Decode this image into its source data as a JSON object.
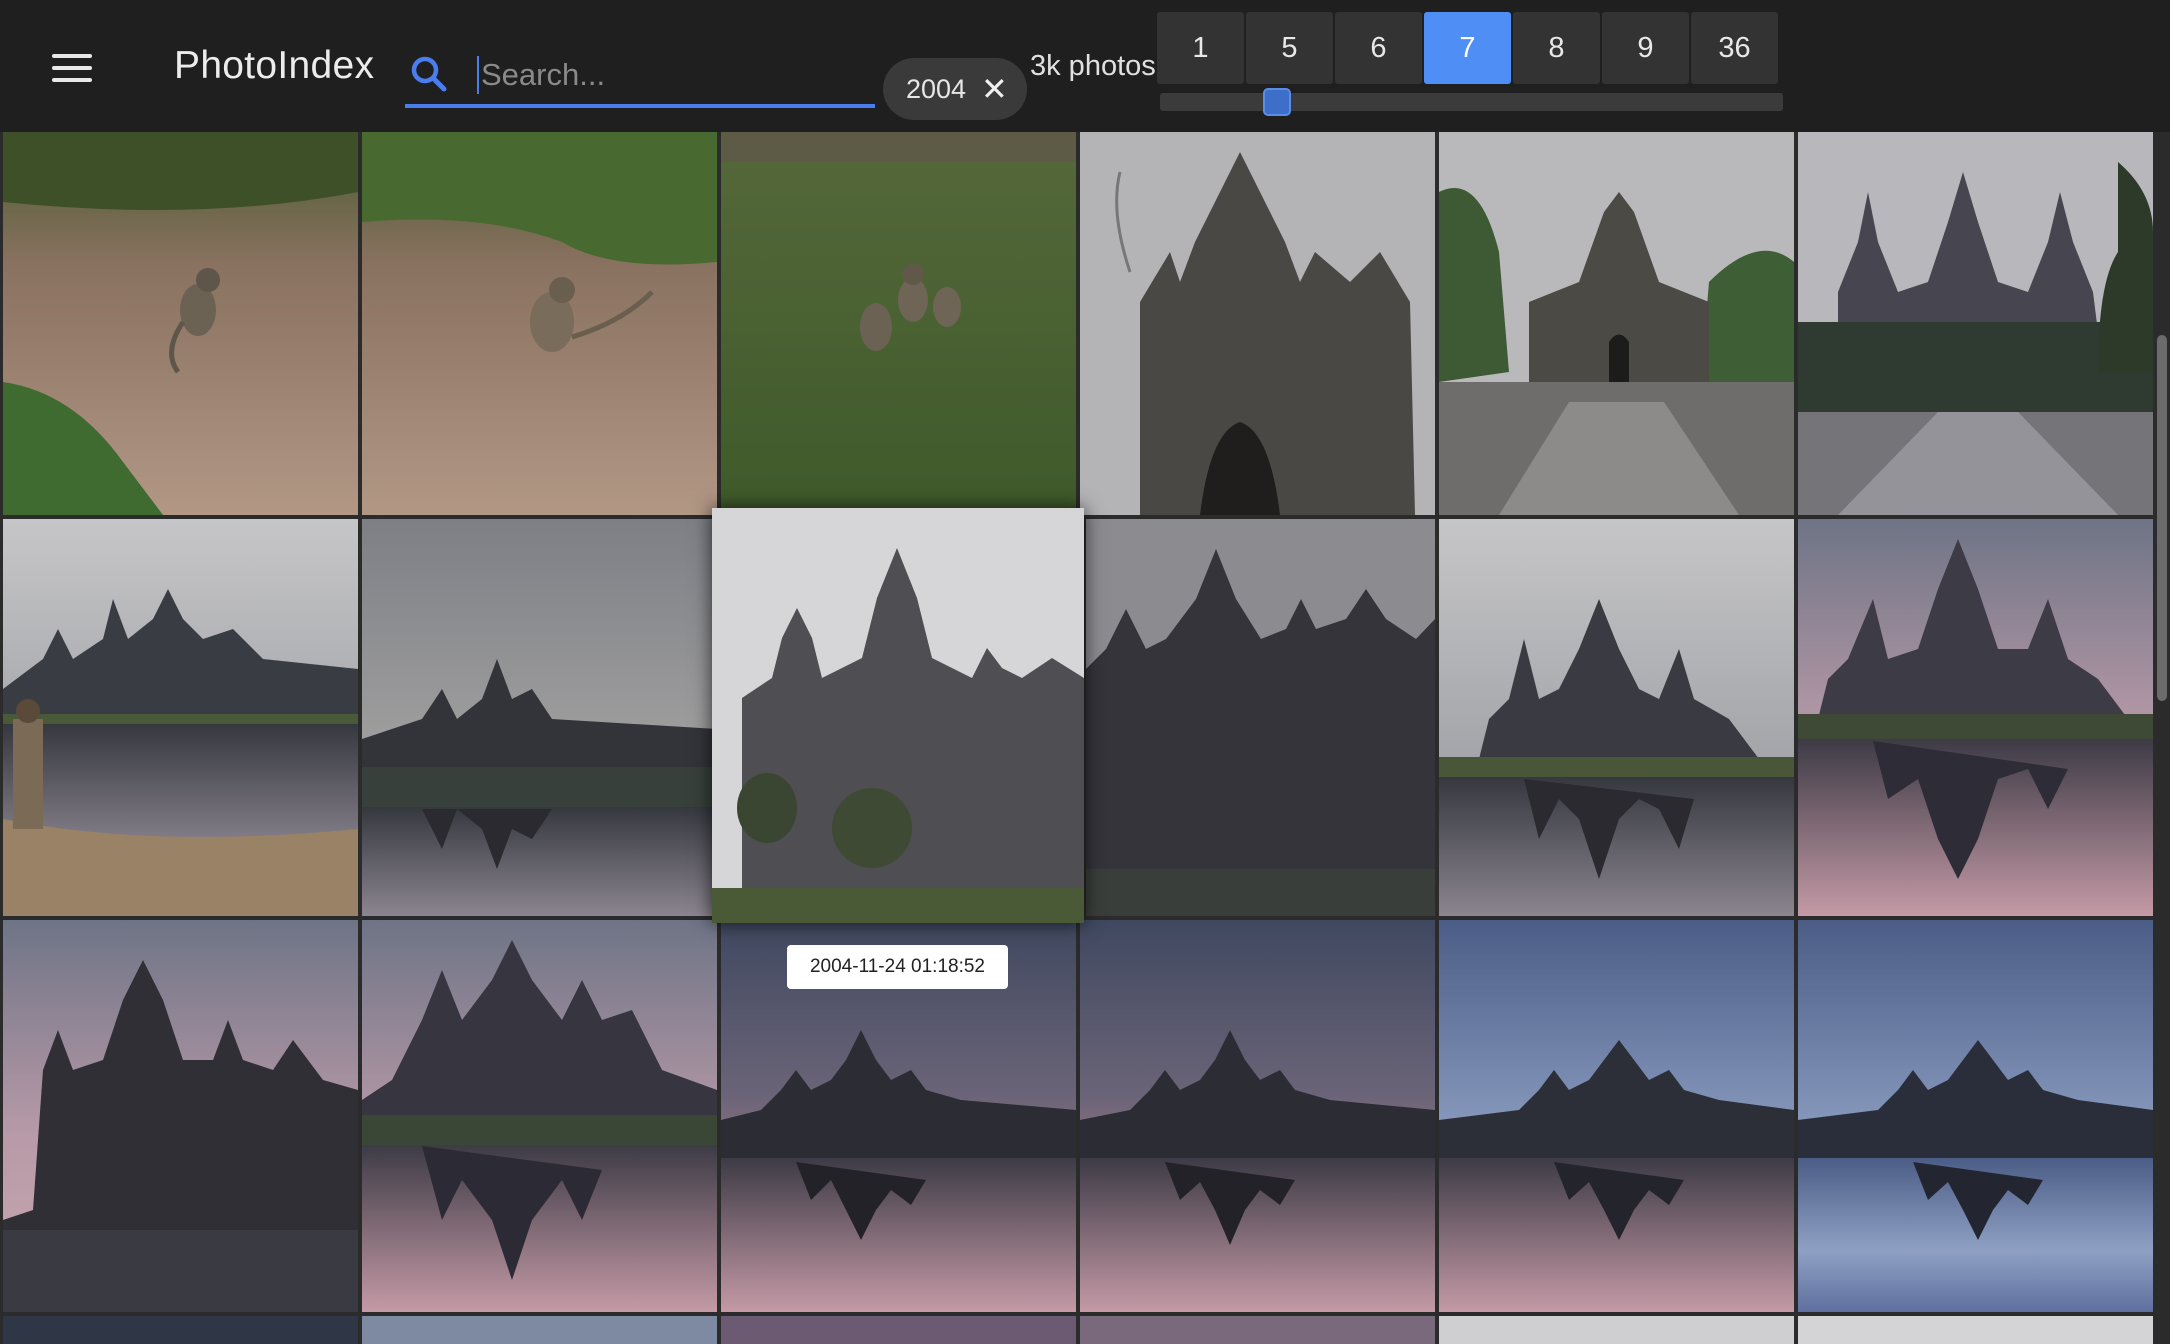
{
  "app": {
    "title": "PhotoIndex"
  },
  "search": {
    "placeholder": "Search...",
    "value": ""
  },
  "filter_chip": {
    "label": "2004",
    "close": "✕"
  },
  "photo_count": "3k photos",
  "zoom_levels": [
    "1",
    "5",
    "6",
    "7",
    "8",
    "9",
    "36"
  ],
  "zoom_active": "7",
  "zoom_slider_fraction": 0.14,
  "tooltip": "2004-11-24 01:18:52",
  "colors": {
    "accent": "#4f8ef5",
    "header_bg": "#1f1f1f",
    "grid_bg": "#2b2b2b"
  },
  "icons": {
    "menu": "hamburger-menu-icon",
    "search": "search-icon",
    "close": "close-icon"
  },
  "photos": [
    {
      "label": "monkey on dirt path"
    },
    {
      "label": "monkey sitting on dirt"
    },
    {
      "label": "monkeys on grass"
    },
    {
      "label": "stone face tower"
    },
    {
      "label": "temple gate with road"
    },
    {
      "label": "causeway to temple"
    },
    {
      "label": "person by pond with temple"
    },
    {
      "label": "temple reflection dusk"
    },
    {
      "label": "temple towers close"
    },
    {
      "label": "dark temple silhouette"
    },
    {
      "label": "temple reflection grey sky"
    },
    {
      "label": "temple reflection pink sky"
    },
    {
      "label": "temple silhouette pink sky"
    },
    {
      "label": "temple reflection pink water"
    },
    {
      "label": "sunrise reflection"
    },
    {
      "label": "sunrise reflection palms"
    },
    {
      "label": "sunrise reflection blue sky"
    },
    {
      "label": "sunrise blue reflection"
    },
    {
      "label": "next row photo"
    },
    {
      "label": "next row photo"
    },
    {
      "label": "next row photo"
    },
    {
      "label": "next row photo"
    },
    {
      "label": "next row photo"
    },
    {
      "label": "next row photo"
    }
  ]
}
